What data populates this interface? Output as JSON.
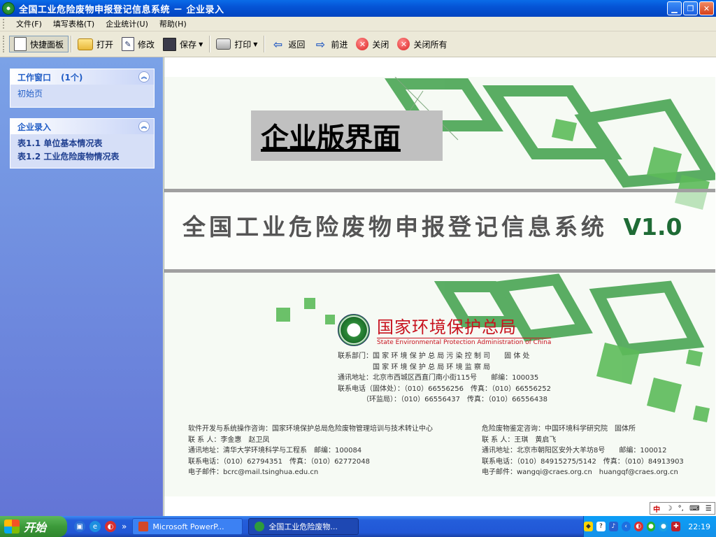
{
  "window": {
    "title": "全国工业危险废物申报登记信息系统 － 企业录入"
  },
  "menubar": {
    "items": [
      "文件(F)",
      "填写表格(T)",
      "企业统计(U)",
      "帮助(H)"
    ]
  },
  "toolbar": {
    "panel": "快捷面板",
    "open": "打开",
    "edit": "修改",
    "save": "保存",
    "print": "打印",
    "back": "返回",
    "forward": "前进",
    "close": "关闭",
    "close_all": "关闭所有"
  },
  "sidebar": {
    "window_group": {
      "title": "工作窗口",
      "count": "(1个)",
      "items": [
        "初始页"
      ]
    },
    "entry_group": {
      "title": "企业录入",
      "items": [
        "表1.1 单位基本情况表",
        "表1.2 工业危险废物情况表"
      ]
    }
  },
  "splash": {
    "banner": "企业版界面",
    "system_title": "全国工业危险废物申报登记信息系统",
    "version": "V1.0",
    "agency_cn": "国家环境保护总局",
    "agency_en": "State Environmental Protection Administration of China",
    "agency_lines": [
      "联系部门：国 家 环 境 保 护 总 局 污 染 控 制 司　　固 体 处",
      "　　　　　国 家 环 境 保 护 总 局 环 境 监 察 局",
      "通讯地址：北京市西城区西直门南小街115号　　邮编：100035",
      "联系电话（固体处）：（010）66556256　传真：（010）66556252",
      "　　　　（环监局）：（010）66556437　传真：（010）66556438"
    ],
    "left_lines": [
      "软件开发与系统操作咨询：国家环境保护总局危险废物管理培训与技术转让中心",
      "联 系 人：李金惠　赵卫凤",
      "通讯地址：清华大学环境科学与工程系　邮编：100084",
      "联系电话：（010）62794351　传真：（010）62772048",
      "电子邮件：bcrc@mail.tsinghua.edu.cn"
    ],
    "right_lines": [
      "危险废物鉴定咨询：中国环境科学研究院　固体所",
      "联 系 人：王琪　黄启飞",
      "通讯地址：北京市朝阳区安外大羊坊8号　　邮编：100012",
      "联系电话：（010）84915275/5142　传真：（010）84913903",
      "电子邮件：wangqi@craes.org.cn　huangqf@craes.org.cn"
    ],
    "ime_label": "中"
  },
  "taskbar": {
    "start": "开始",
    "tasks": [
      "Microsoft PowerP...",
      "全国工业危险废物..."
    ],
    "clock": "22:19"
  }
}
